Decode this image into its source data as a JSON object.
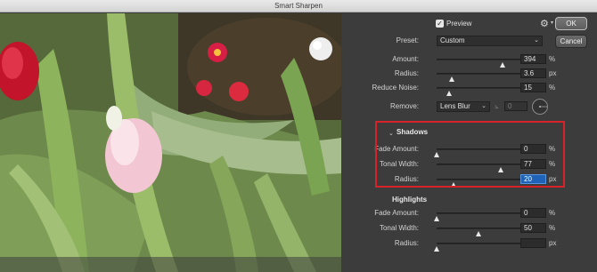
{
  "window": {
    "title": "Smart Sharpen"
  },
  "buttons": {
    "ok": "OK",
    "cancel": "Cancel"
  },
  "preview_toggle": {
    "label": "Preview",
    "checked": true
  },
  "preset": {
    "label": "Preset:",
    "value": "Custom"
  },
  "main": {
    "amount": {
      "label": "Amount:",
      "value": "394",
      "unit": "%",
      "level": 0.79
    },
    "radius": {
      "label": "Radius:",
      "value": "3.6",
      "unit": "px",
      "level": 0.18
    },
    "reduce_noise": {
      "label": "Reduce Noise:",
      "value": "15",
      "unit": "%",
      "level": 0.15
    },
    "remove": {
      "label": "Remove:",
      "value": "Lens Blur",
      "angle_value": "0"
    }
  },
  "shadows": {
    "title": "Shadows",
    "fade_amount": {
      "label": "Fade Amount:",
      "value": "0",
      "unit": "%",
      "level": 0.0
    },
    "tonal_width": {
      "label": "Tonal Width:",
      "value": "77",
      "unit": "%",
      "level": 0.77
    },
    "radius": {
      "label": "Radius:",
      "value": "20",
      "unit": "px",
      "level": 0.2
    }
  },
  "highlights": {
    "title": "Highlights",
    "fade_amount": {
      "label": "Fade Amount:",
      "value": "0",
      "unit": "%",
      "level": 0.0
    },
    "tonal_width": {
      "label": "Tonal Width:",
      "value": "50",
      "unit": "%",
      "level": 0.5
    },
    "radius": {
      "label": "Radius:",
      "value": "",
      "unit": "px",
      "level": 0.0
    }
  },
  "colors": {
    "highlight_box": "#d72229",
    "focus_field": "#1f63b8"
  },
  "icons": {
    "gear": "gear-icon",
    "collapse": "chevron-down-icon"
  }
}
